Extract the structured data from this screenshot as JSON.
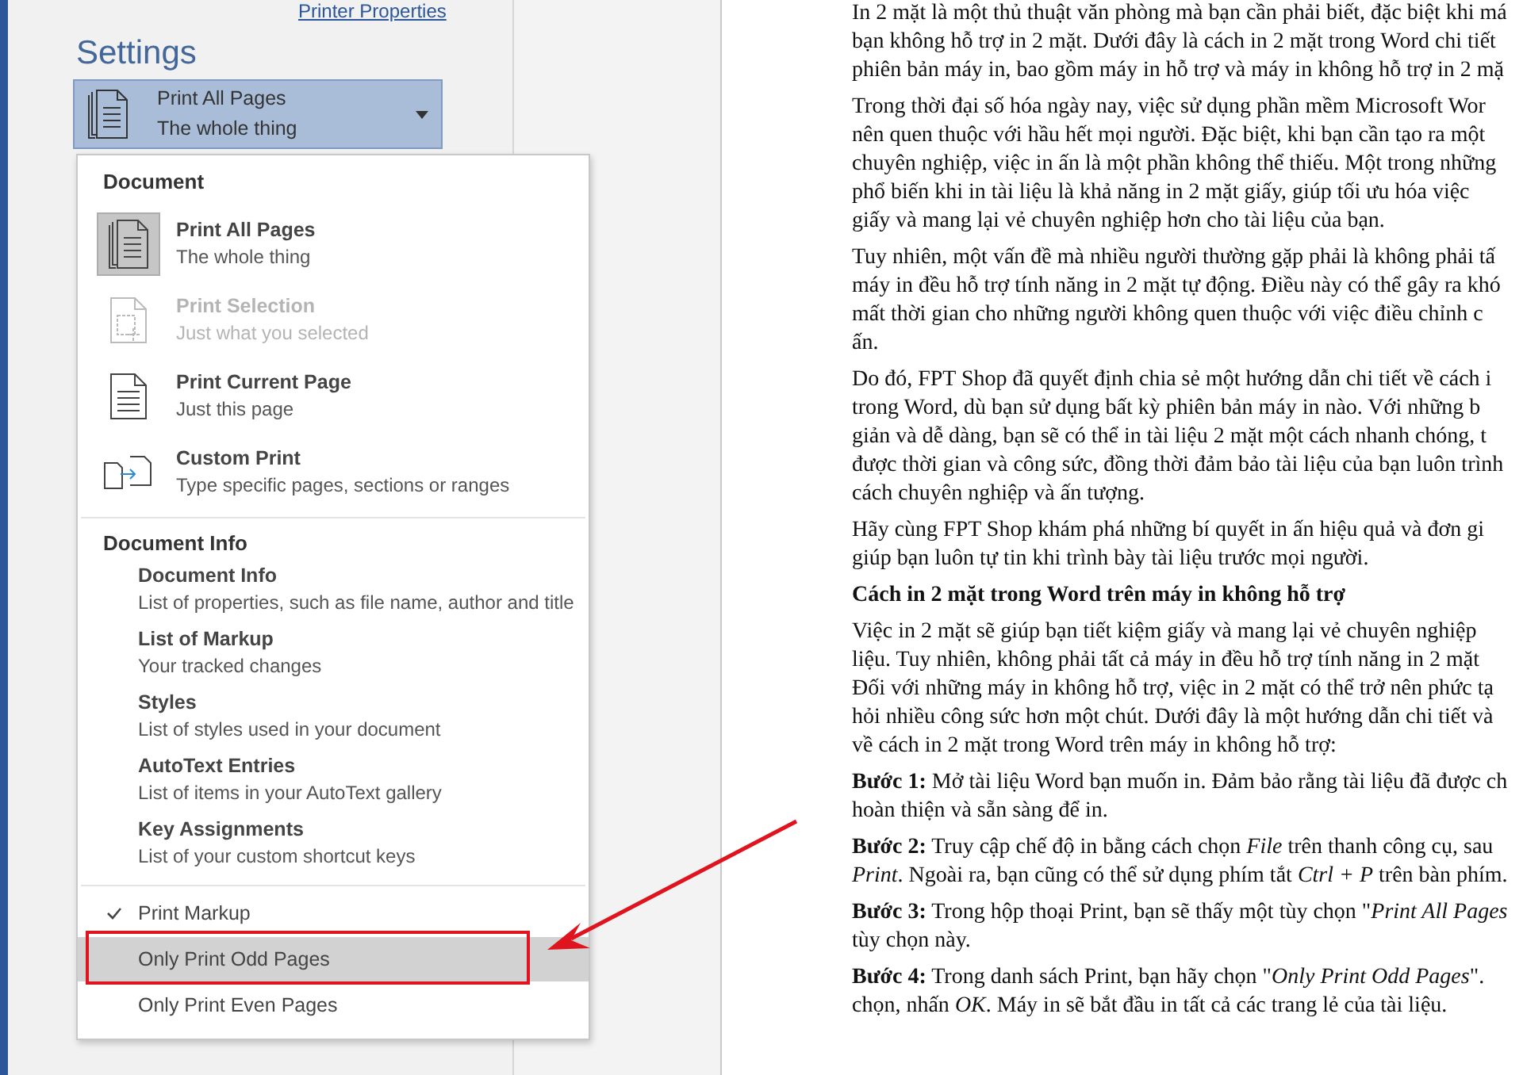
{
  "backstage": {
    "printer_link": "Printer Properties",
    "settings_title": "Settings",
    "dropdown": {
      "title": "Print All Pages",
      "subtitle": "The whole thing",
      "expanded": true
    }
  },
  "menu": {
    "document_header": "Document",
    "document_items": [
      {
        "kind": "all-pages",
        "title": "Print All Pages",
        "subtitle": "The whole thing",
        "selected": true,
        "disabled": false
      },
      {
        "kind": "selection",
        "title": "Print Selection",
        "subtitle": "Just what you selected",
        "selected": false,
        "disabled": true
      },
      {
        "kind": "current-page",
        "title": "Print Current Page",
        "subtitle": "Just this page",
        "selected": false,
        "disabled": false
      },
      {
        "kind": "custom",
        "title": "Custom Print",
        "subtitle": "Type specific pages, sections or ranges",
        "selected": false,
        "disabled": false
      }
    ],
    "info_header": "Document Info",
    "info_items": [
      {
        "title": "Document Info",
        "subtitle": "List of properties, such as file name, author and title"
      },
      {
        "title": "List of Markup",
        "subtitle": "Your tracked changes"
      },
      {
        "title": "Styles",
        "subtitle": "List of styles used in your document"
      },
      {
        "title": "AutoText Entries",
        "subtitle": "List of items in your AutoText gallery"
      },
      {
        "title": "Key Assignments",
        "subtitle": "List of your custom shortcut keys"
      }
    ],
    "options": [
      {
        "label": "Print Markup",
        "checked": true,
        "highlighted": false,
        "annotated": false
      },
      {
        "label": "Only Print Odd Pages",
        "checked": false,
        "highlighted": true,
        "annotated": true
      },
      {
        "label": "Only Print Even Pages",
        "checked": false,
        "highlighted": false,
        "annotated": false
      }
    ]
  },
  "document": {
    "blocks": [
      {
        "kind": "paragraph",
        "text": "In 2 mặt là một thủ thuật văn phòng mà bạn cần phải biết, đặc biệt khi má\nbạn không hỗ trợ in 2 mặt. Dưới đây là cách in 2 mặt trong Word chi tiết\nphiên bản máy in, bao gồm máy in hỗ trợ và máy in không hỗ trợ in 2 mặ"
      },
      {
        "kind": "paragraph",
        "text": "Trong thời đại số hóa ngày nay, việc sử dụng phần mềm Microsoft Wor\nnên quen thuộc với hầu hết mọi người. Đặc biệt, khi bạn cần tạo ra một\nchuyên nghiệp, việc in ấn là một phần không thể thiếu. Một trong những\nphổ biến khi in tài liệu là khả năng in 2 mặt giấy, giúp tối ưu hóa việc\ngiấy và mang lại vẻ chuyên nghiệp hơn cho tài liệu của bạn."
      },
      {
        "kind": "paragraph",
        "text": "Tuy nhiên, một vấn đề mà nhiều người thường gặp phải là không phải tấ\nmáy in đều hỗ trợ tính năng in 2 mặt tự động. Điều này có thể gây ra khó\nmất thời gian cho những người không quen thuộc với việc điều chỉnh c\nấn."
      },
      {
        "kind": "paragraph",
        "text": "Do đó, FPT Shop đã quyết định chia sẻ một hướng dẫn chi tiết về cách i\ntrong Word, dù bạn sử dụng bất kỳ phiên bản máy in nào. Với những b\ngiản và dễ dàng, bạn sẽ có thể in tài liệu 2 mặt một cách nhanh chóng, t\nđược thời gian và công sức, đồng thời đảm bảo tài liệu của bạn luôn trình\ncách chuyên nghiệp và ấn tượng."
      },
      {
        "kind": "paragraph",
        "text": "Hãy cùng FPT Shop khám phá những bí quyết in ấn hiệu quả và đơn gi\ngiúp bạn luôn tự tin khi trình bày tài liệu trước mọi người."
      },
      {
        "kind": "heading",
        "text": "Cách in 2 mặt trong Word trên máy in không hỗ trợ"
      },
      {
        "kind": "paragraph",
        "text": "Việc in 2 mặt sẽ giúp bạn tiết kiệm giấy và mang lại vẻ chuyên nghiệp\nliệu. Tuy nhiên, không phải tất cả máy in đều hỗ trợ tính năng in 2 mặt\nĐối với những máy in không hỗ trợ, việc in 2 mặt có thể trở nên phức tạ\nhỏi nhiều công sức hơn một chút. Dưới đây là một hướng dẫn chi tiết và\nvề cách in 2 mặt trong Word trên máy in không hỗ trợ:"
      },
      {
        "kind": "paragraph",
        "text": "**Bước 1:** Mở tài liệu Word bạn muốn in. Đảm bảo rằng tài liệu đã được ch\nhoàn thiện và sẵn sàng để in."
      },
      {
        "kind": "paragraph",
        "text": "**Bước 2:** Truy cập chế độ in bằng cách chọn *File* trên thanh công cụ, sau\n*Print*. Ngoài ra, bạn cũng có thể sử dụng phím tắt *Ctrl + P* trên bàn phím."
      },
      {
        "kind": "paragraph",
        "text": "**Bước 3:** Trong hộp thoại Print, bạn sẽ thấy một tùy chọn \"*Print All Pages*\ntùy chọn này."
      },
      {
        "kind": "paragraph",
        "text": "**Bước 4:** Trong danh sách Print, bạn hãy chọn \"*Only Print Odd Pages*\".\nchọn, nhấn *OK*. Máy in sẽ bắt đầu in tất cả các trang lẻ của tài liệu."
      }
    ]
  }
}
